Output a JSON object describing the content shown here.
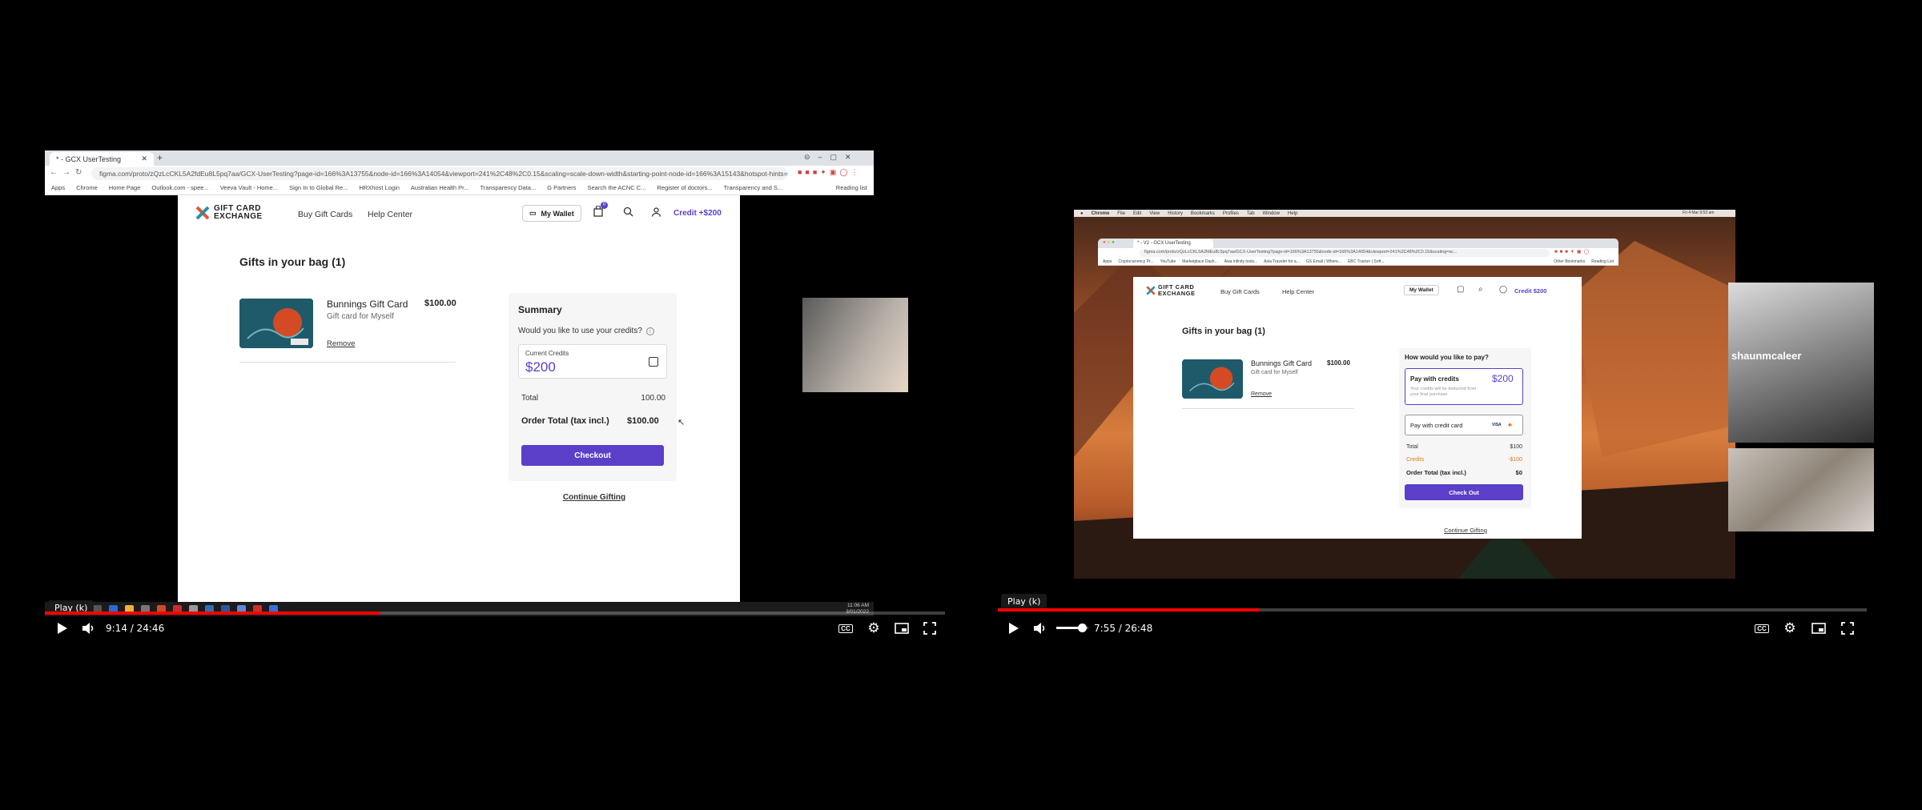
{
  "left_video": {
    "browser": {
      "tab_title": "* - GCX UserTesting",
      "url": "figma.com/proto/zQzLcCKL5A2fdEu8L5pq7aa/GCX-UserTesting?page-id=166%3A13755&node-id=166%3A14054&viewport=241%2C48%2C0.15&scaling=scale-down-width&starting-point-node-id=166%3A15143&hotspot-hints=0&hide-ui=1",
      "bookmarks": [
        "Apps",
        "Chrome",
        "Home Page",
        "Outlook.com - spee...",
        "Veeva Vault - Home...",
        "Sign In to Global Re...",
        "HRXhost Login",
        "Australian Health Pr...",
        "Transparency Data...",
        "G Partners",
        "Search the ACNC C...",
        "Register of doctors...",
        "Transparency and S..."
      ],
      "reading_list": "Reading list"
    },
    "site": {
      "logo_line1": "GIFT CARD",
      "logo_line2": "EXCHANGE",
      "nav_buy": "Buy Gift Cards",
      "nav_help": "Help Center",
      "wallet": "My Wallet",
      "cart_badge": "0",
      "credit": "Credit +$200"
    },
    "bag": {
      "heading": "Gifts in your bag (1)",
      "item_name": "Bunnings Gift Card",
      "item_sub": "Gift card for Myself",
      "item_price": "$100.00",
      "remove": "Remove"
    },
    "summary": {
      "title": "Summary",
      "question": "Would you like to use your credits?",
      "credits_label": "Current Credits",
      "credits_value": "$200",
      "total_label": "Total",
      "total_value": "100.00",
      "order_label": "Order Total (tax incl.)",
      "order_value": "$100.00",
      "checkout": "Checkout",
      "continue": "Continue Gifting"
    },
    "taskbar_time": "11:06 AM",
    "taskbar_date": "3/01/2022",
    "player": {
      "tooltip": "Play (k)",
      "time": "9:14 / 24:46",
      "progress": 0.373,
      "cc": "CC"
    }
  },
  "right_video": {
    "mac_menu": [
      "Chrome",
      "File",
      "Edit",
      "View",
      "History",
      "Bookmarks",
      "Profiles",
      "Tab",
      "Window",
      "Help"
    ],
    "mac_clock": "Fri 4 Mar 9:53 am",
    "browser": {
      "tab_title": "* - V2 - GCX UserTesting",
      "url": "figma.com/proto/zQzLcCKL5A2fdEu8L5pq7aa/GCX-UserTesting?page-id=166%3A13755&node-id=166%3A14054&viewport=241%2C48%2C0.15&scaling=sc...",
      "bookmarks": [
        "Apps",
        "Cryptocurrency Pr...",
        "YouTube",
        "Marketplace Dash...",
        "Asia infinity tools...",
        "Asia Traveler for a...",
        "GS Email | Where...",
        "EBC Tracker | Soft..."
      ],
      "other_bookmarks": "Other Bookmarks",
      "reading_list": "Reading List"
    },
    "site": {
      "logo_line1": "GIFT CARD",
      "logo_line2": "EXCHANGE",
      "nav_buy": "Buy Gift Cards",
      "nav_help": "Help Center",
      "wallet": "My Wallet",
      "credit": "Credit $200"
    },
    "bag": {
      "heading": "Gifts in your bag (1)",
      "item_name": "Bunnings Gift Card",
      "item_sub": "Gift card for Myself",
      "item_price": "$100.00",
      "remove": "Remove"
    },
    "pay": {
      "question": "How would you like to pay?",
      "credits_title": "Pay with credits",
      "credits_amount": "$200",
      "credits_note": "Your credits will be deducted from your final purchase",
      "card_title": "Pay with credit card",
      "card_brand": "VISA",
      "total_label": "Total",
      "total_value": "$100",
      "credits_label": "Credits",
      "credits_value": "-$100",
      "order_label": "Order Total (tax incl.)",
      "order_value": "$0",
      "checkout": "Check Out",
      "continue": "Continue Gifting"
    },
    "cam_name": "shaunmcaleer",
    "player": {
      "tooltip": "Play (k)",
      "time": "7:55 / 26:48",
      "progress": 0.3,
      "volume": 0.8,
      "cc": "CC"
    }
  },
  "colors": {
    "brand": "#5b3fc8",
    "progress": "#ff0000",
    "credits_orange": "#e07b1f"
  }
}
